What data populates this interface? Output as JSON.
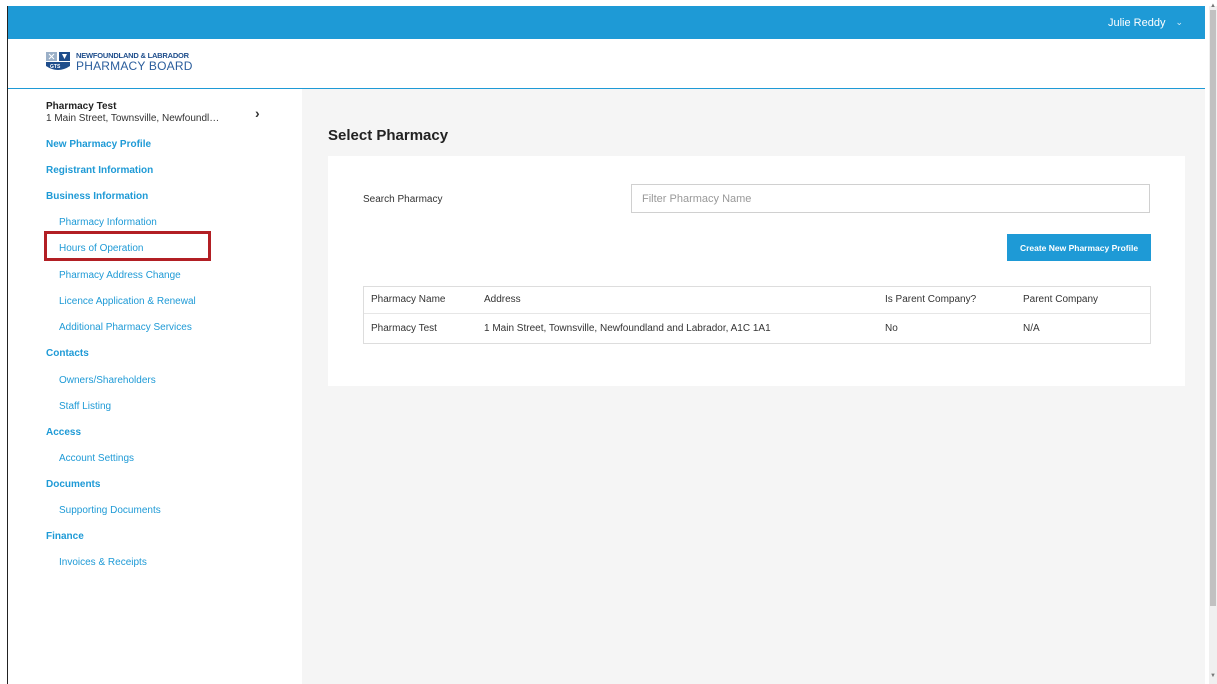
{
  "topbar": {
    "user_name": "Julie Reddy",
    "user_chevron": "⌄"
  },
  "logo": {
    "line1": "NEWFOUNDLAND & LABRADOR",
    "line2": "PHARMACY BOARD"
  },
  "sidebar": {
    "pharmacy_name": "Pharmacy Test",
    "pharmacy_address": "1 Main Street, Townsville, Newfoundla...",
    "chevron": "›",
    "sections": [
      {
        "label": "New Pharmacy Profile"
      },
      {
        "label": "Registrant Information"
      },
      {
        "label": "Business Information",
        "items": [
          "Pharmacy Information",
          "Hours of Operation",
          "Pharmacy Address Change",
          "Licence Application & Renewal",
          "Additional Pharmacy Services"
        ]
      },
      {
        "label": "Contacts",
        "items": [
          "Owners/Shareholders",
          "Staff Listing"
        ]
      },
      {
        "label": "Access",
        "items": [
          "Account Settings"
        ]
      },
      {
        "label": "Documents",
        "items": [
          "Supporting Documents"
        ]
      },
      {
        "label": "Finance",
        "items": [
          "Invoices & Receipts"
        ]
      }
    ],
    "highlighted_item": "Hours of Operation"
  },
  "main": {
    "title": "Select Pharmacy",
    "search_label": "Search Pharmacy",
    "search_placeholder": "Filter Pharmacy Name",
    "search_value": "",
    "create_button": "Create New Pharmacy Profile",
    "table": {
      "columns": [
        "Pharmacy Name",
        "Address",
        "Is Parent Company?",
        "Parent Company"
      ],
      "rows": [
        [
          "Pharmacy Test",
          "1 Main Street, Townsville, Newfoundland and Labrador, A1C 1A1",
          "No",
          "N/A"
        ]
      ]
    }
  },
  "colors": {
    "brand_blue": "#1e9ad6",
    "highlight_red": "#b21f24",
    "logo_navy": "#1f4e8c"
  }
}
